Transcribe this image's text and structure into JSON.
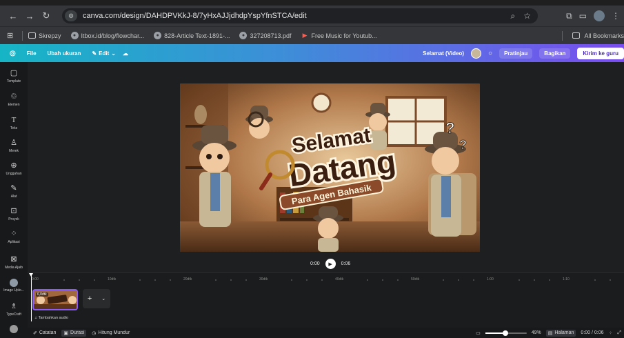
{
  "browser": {
    "url": "canva.com/design/DAHDPVKkJ-8/7yHxAJJjdhdpYspYfnSTCA/edit",
    "bookmarks": [
      {
        "label": "Skrepzy",
        "icon": "folder-icon"
      },
      {
        "label": "Itbox.id/blog/flowchar...",
        "icon": "globe-icon"
      },
      {
        "label": "828-Article Text-1891-...",
        "icon": "globe-icon"
      },
      {
        "label": "327208713.pdf",
        "icon": "globe-icon"
      },
      {
        "label": "Free Music for Youtub...",
        "icon": "music-icon"
      }
    ],
    "all_bookmarks": "All Bookmarks"
  },
  "header": {
    "file": "File",
    "resize": "Ubah ukuran",
    "edit": "Edit",
    "title": "Selamat (Video)",
    "preview": "Pratinjau",
    "share": "Bagikan",
    "submit": "Kirim ke guru"
  },
  "sidebar": {
    "items": [
      {
        "label": "Template",
        "icon": "template-icon"
      },
      {
        "label": "Elemen",
        "icon": "elements-icon"
      },
      {
        "label": "Teks",
        "icon": "text-icon"
      },
      {
        "label": "Merek",
        "icon": "brand-icon"
      },
      {
        "label": "Unggahan",
        "icon": "upload-icon"
      },
      {
        "label": "Alat",
        "icon": "draw-icon"
      },
      {
        "label": "Proyek",
        "icon": "folder-icon"
      },
      {
        "label": "Aplikasi",
        "icon": "apps-icon"
      },
      {
        "label": "Media Ajaib",
        "icon": "magic-media-icon"
      },
      {
        "label": "Image Uplo...",
        "icon": "image-upload-app-icon"
      },
      {
        "label": "TypeCraft",
        "icon": "typecraft-icon"
      }
    ]
  },
  "design": {
    "title_line1": "Selamat",
    "title_line2": "Datang",
    "subtitle": "Para Agen Bahasik"
  },
  "player": {
    "current": "0:00",
    "total": "0:06"
  },
  "timeline": {
    "ticks": [
      "0:00",
      "10dtk",
      "20dtk",
      "30dtk",
      "40dtk",
      "50dtk",
      "1:00",
      "1:10"
    ],
    "clip_duration": "6,0dtk",
    "add_audio": "Tambahkan audio"
  },
  "status": {
    "notes": "Catatan",
    "duration": "Durasi",
    "timer": "Hitung Mundur",
    "zoom": "49%",
    "zoom_value": 0.49,
    "pages": "Halaman",
    "time": "0:00 / 0:06"
  }
}
